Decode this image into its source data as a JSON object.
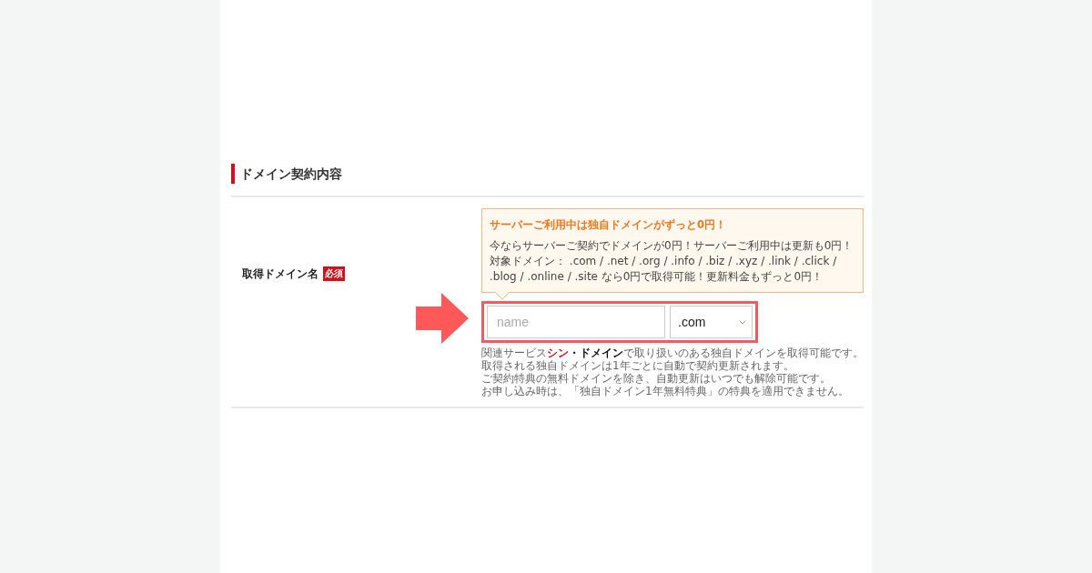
{
  "section": {
    "title": "ドメイン契約内容"
  },
  "row": {
    "label": "取得ドメイン名",
    "required_badge": "必須",
    "promo": {
      "title": "サーバーご利用中は独自ドメインがずっと0円！",
      "lines": [
        "今ならサーバーご契約でドメインが0円！サーバーご利用中は更新も0円！",
        "対象ドメイン： .com / .net / .org / .info / .biz / .xyz / .link / .click /",
        ".blog / .online / .site なら0円で取得可能！更新料金もずっと0円！"
      ]
    },
    "domain_input": {
      "placeholder": "name"
    },
    "tld_select": {
      "value": ".com"
    },
    "highlighted": true,
    "note_first": {
      "before": "関連サービス",
      "brand_red": "シン",
      "brand_dark": "・ドメイン",
      "after": "で取り扱いのある独自ドメインを取得可能です。"
    },
    "notes": [
      "取得される独自ドメインは1年ごとに自動で契約更新されます。",
      "ご契約特典の無料ドメインを除き、自動更新はいつでも解除可能です。",
      "お申し込み時は、「独自ドメイン1年無料特典」の特典を適用できません。"
    ]
  }
}
